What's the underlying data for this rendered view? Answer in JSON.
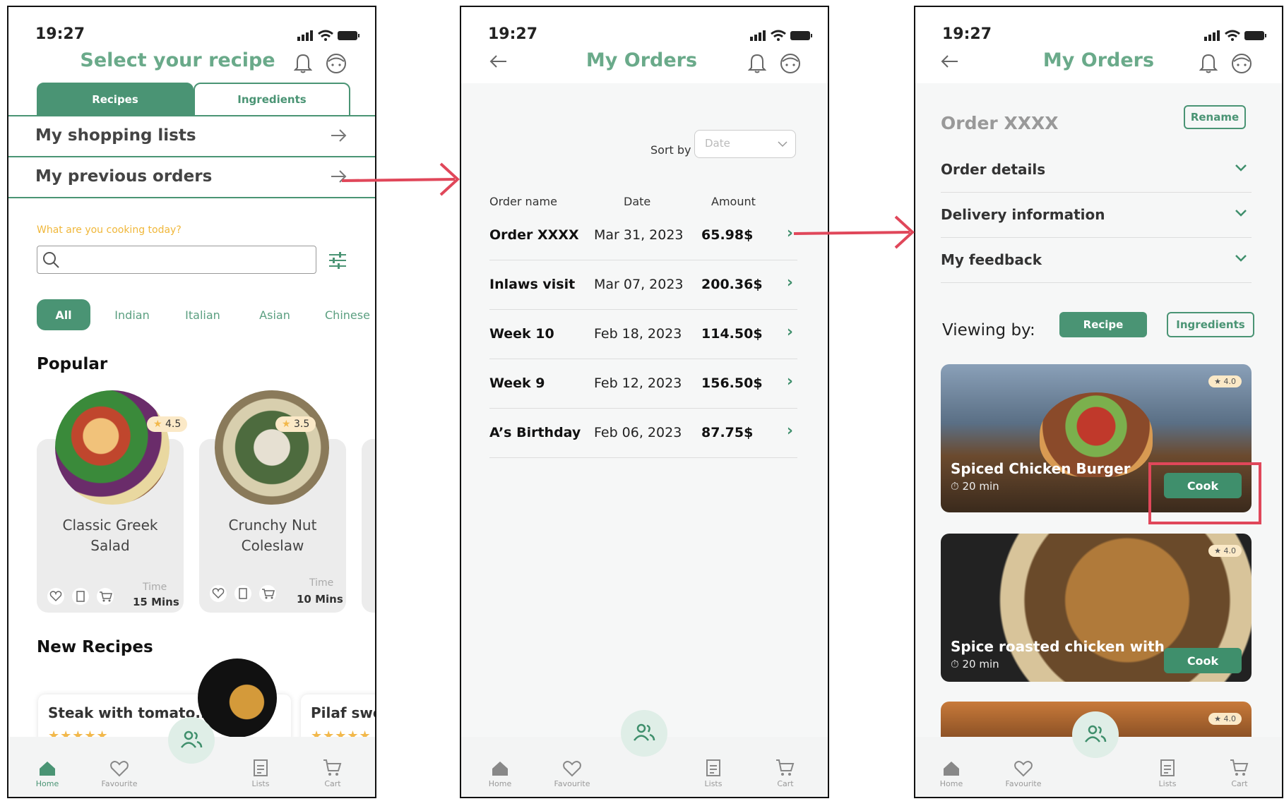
{
  "status_time": "19:27",
  "colors": {
    "accent": "#4a9474",
    "title": "#6aaa8a",
    "arrow": "#e0475a",
    "star": "#f2b84b"
  },
  "screen1": {
    "title": "Select your recipe",
    "tabs": [
      "Recipes",
      "Ingredients"
    ],
    "rows": [
      "My shopping lists",
      "My previous orders"
    ],
    "search_prompt": "What are  you cooking today?",
    "chips": [
      "All",
      "Indian",
      "Italian",
      "Asian",
      "Chinese"
    ],
    "popular_heading": "Popular",
    "popular": [
      {
        "name_l1": "Classic Greek",
        "name_l2": "Salad",
        "rating": "4.5",
        "time_label": "Time",
        "time": "15 Mins"
      },
      {
        "name_l1": "Crunchy Nut",
        "name_l2": "Coleslaw",
        "rating": "3.5",
        "time_label": "Time",
        "time": "10 Mins"
      }
    ],
    "new_heading": "New Recipes",
    "new_recipes": [
      "Steak with tomato..",
      "Pilaf swee"
    ],
    "stars": "★★★★★"
  },
  "nav": [
    "Home",
    "Favourite",
    "Lists",
    "Cart"
  ],
  "screen2": {
    "title": "My Orders",
    "sort_label": "Sort by",
    "sort_placeholder": "Date",
    "columns": [
      "Order name",
      "Date",
      "Amount"
    ],
    "orders": [
      {
        "name": "Order XXXX",
        "date": "Mar 31, 2023",
        "amount": "65.98$"
      },
      {
        "name": "Inlaws visit",
        "date": "Mar 07, 2023",
        "amount": "200.36$"
      },
      {
        "name": "Week 10",
        "date": "Feb 18, 2023",
        "amount": "114.50$"
      },
      {
        "name": "Week 9",
        "date": "Feb 12, 2023",
        "amount": "156.50$"
      },
      {
        "name": "A’s Birthday",
        "date": "Feb 06, 2023",
        "amount": "87.75$"
      }
    ]
  },
  "screen3": {
    "title": "My Orders",
    "order_name": "Order XXXX",
    "rename": "Rename",
    "accordions": [
      "Order details",
      "Delivery information",
      "My feedback"
    ],
    "viewing_by": "Viewing by:",
    "view_tabs": [
      "Recipe",
      "Ingredients"
    ],
    "recipes": [
      {
        "name": "Spiced Chicken Burger",
        "time": "20 min",
        "rating": "★ 4.0",
        "cook": "Cook"
      },
      {
        "name": "Spice roasted chicken with...",
        "time": "20 min",
        "rating": "★ 4.0",
        "cook": "Cook"
      },
      {
        "rating": "★ 4.0"
      }
    ]
  }
}
